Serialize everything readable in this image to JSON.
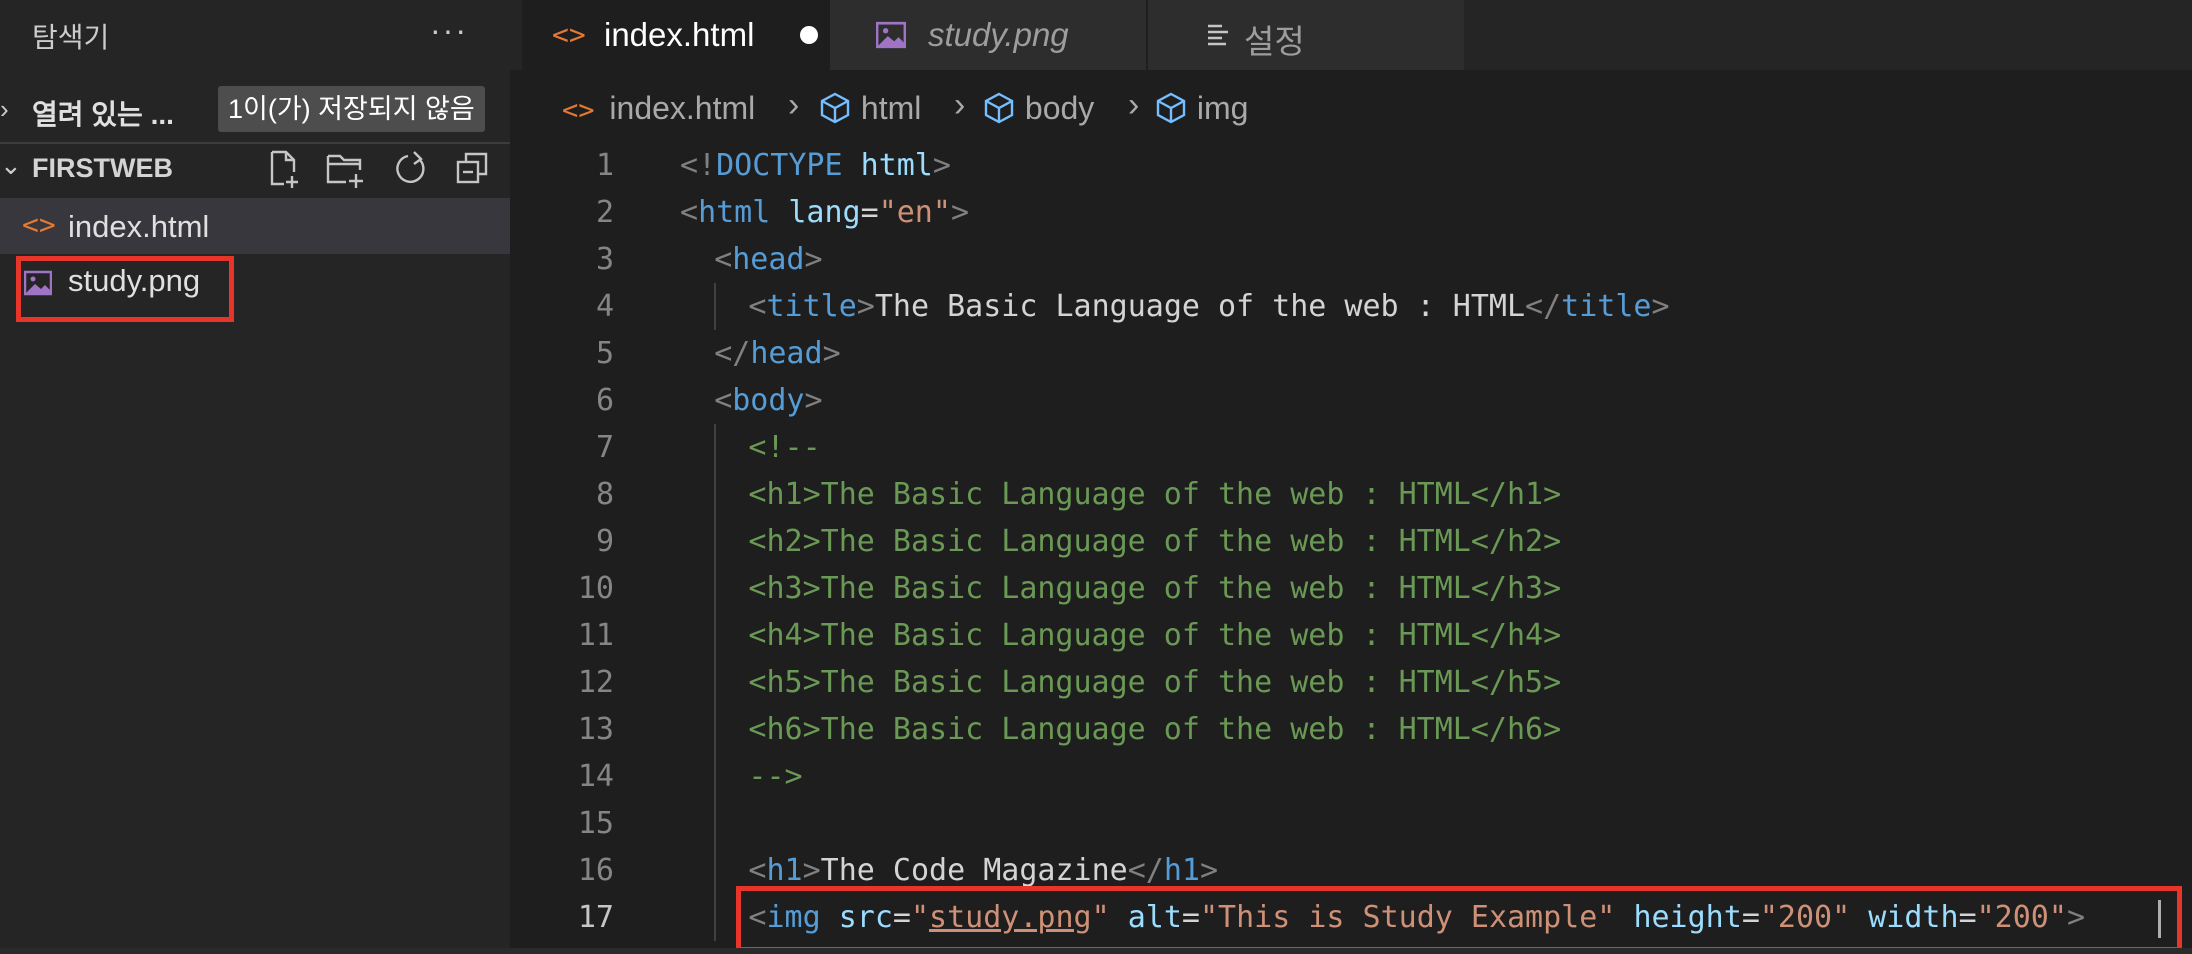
{
  "sidebar": {
    "title": "탐색기",
    "more_label": "···",
    "open_editors_label": "열려 있는 ...",
    "unsaved_badge": "1이(가) 저장되지 않음",
    "folder_label": "FIRSTWEB",
    "toolbar_icons": [
      "new-file-icon",
      "new-folder-icon",
      "refresh-icon",
      "collapse-all-icon"
    ],
    "files": [
      {
        "name": "index.html",
        "icon": "html-file-icon",
        "selected": true
      },
      {
        "name": "study.png",
        "icon": "image-file-icon",
        "selected": false
      }
    ]
  },
  "tabs": [
    {
      "label": "index.html",
      "icon": "html-file-icon",
      "active": true,
      "dirty": true
    },
    {
      "label": "study.png",
      "icon": "image-file-icon",
      "active": false,
      "preview": true
    },
    {
      "label": "설정",
      "icon": "settings-list-icon",
      "active": false
    }
  ],
  "breadcrumb": [
    "index.html",
    "html",
    "body",
    "img"
  ],
  "code": {
    "active_line": 17,
    "lines": [
      {
        "n": "1",
        "tokens": [
          [
            "tg",
            "<!"
          ],
          [
            "tn",
            "DOCTYPE"
          ],
          [
            "tx",
            " "
          ],
          [
            "at",
            "html"
          ],
          [
            "tg",
            ">"
          ]
        ],
        "indent": 0
      },
      {
        "n": "2",
        "tokens": [
          [
            "tg",
            "<"
          ],
          [
            "tn",
            "html"
          ],
          [
            "tx",
            " "
          ],
          [
            "at",
            "lang"
          ],
          [
            "tx",
            "="
          ],
          [
            "st",
            "\"en\""
          ],
          [
            "tg",
            ">"
          ]
        ],
        "indent": 0
      },
      {
        "n": "3",
        "tokens": [
          [
            "tg",
            "<"
          ],
          [
            "tn",
            "head"
          ],
          [
            "tg",
            ">"
          ]
        ],
        "indent": 1
      },
      {
        "n": "4",
        "tokens": [
          [
            "tg",
            "<"
          ],
          [
            "tn",
            "title"
          ],
          [
            "tg",
            ">"
          ],
          [
            "tx",
            "The Basic Language of the web : HTML"
          ],
          [
            "tg",
            "</"
          ],
          [
            "tn",
            "title"
          ],
          [
            "tg",
            ">"
          ]
        ],
        "indent": 2
      },
      {
        "n": "5",
        "tokens": [
          [
            "tg",
            "</"
          ],
          [
            "tn",
            "head"
          ],
          [
            "tg",
            ">"
          ]
        ],
        "indent": 1
      },
      {
        "n": "6",
        "tokens": [
          [
            "tg",
            "<"
          ],
          [
            "tn",
            "body"
          ],
          [
            "tg",
            ">"
          ]
        ],
        "indent": 1
      },
      {
        "n": "7",
        "tokens": [
          [
            "cm",
            "<!--"
          ]
        ],
        "indent": 2
      },
      {
        "n": "8",
        "tokens": [
          [
            "cm",
            "<h1>The Basic Language of the web : HTML</h1>"
          ]
        ],
        "indent": 2
      },
      {
        "n": "9",
        "tokens": [
          [
            "cm",
            "<h2>The Basic Language of the web : HTML</h2>"
          ]
        ],
        "indent": 2
      },
      {
        "n": "10",
        "tokens": [
          [
            "cm",
            "<h3>The Basic Language of the web : HTML</h3>"
          ]
        ],
        "indent": 2
      },
      {
        "n": "11",
        "tokens": [
          [
            "cm",
            "<h4>The Basic Language of the web : HTML</h4>"
          ]
        ],
        "indent": 2
      },
      {
        "n": "12",
        "tokens": [
          [
            "cm",
            "<h5>The Basic Language of the web : HTML</h5>"
          ]
        ],
        "indent": 2
      },
      {
        "n": "13",
        "tokens": [
          [
            "cm",
            "<h6>The Basic Language of the web : HTML</h6>"
          ]
        ],
        "indent": 2
      },
      {
        "n": "14",
        "tokens": [
          [
            "cm",
            "-->"
          ]
        ],
        "indent": 2
      },
      {
        "n": "15",
        "tokens": [],
        "indent": 2
      },
      {
        "n": "16",
        "tokens": [
          [
            "tg",
            "<"
          ],
          [
            "tn",
            "h1"
          ],
          [
            "tg",
            ">"
          ],
          [
            "tx",
            "The Code Magazine"
          ],
          [
            "tg",
            "</"
          ],
          [
            "tn",
            "h1"
          ],
          [
            "tg",
            ">"
          ]
        ],
        "indent": 2
      },
      {
        "n": "17",
        "tokens": [
          [
            "tg",
            "<"
          ],
          [
            "tn",
            "img"
          ],
          [
            "tx",
            " "
          ],
          [
            "at",
            "src"
          ],
          [
            "tx",
            "="
          ],
          [
            "st",
            "\""
          ],
          [
            "stu",
            "study.png"
          ],
          [
            "st",
            "\""
          ],
          [
            "tx",
            " "
          ],
          [
            "at",
            "alt"
          ],
          [
            "tx",
            "="
          ],
          [
            "st",
            "\"This is Study Example\""
          ],
          [
            "tx",
            " "
          ],
          [
            "at",
            "height"
          ],
          [
            "tx",
            "="
          ],
          [
            "st",
            "\"200\""
          ],
          [
            "tx",
            " "
          ],
          [
            "at",
            "width"
          ],
          [
            "tx",
            "="
          ],
          [
            "st",
            "\"200\""
          ],
          [
            "tg",
            ">"
          ]
        ],
        "indent": 2
      }
    ]
  },
  "colors": {
    "highlight_box": "#e8352a",
    "tag_name": "#569cd6",
    "attribute": "#9cdcfe",
    "string": "#ce9178",
    "comment": "#6a9955",
    "html_icon": "#e37933",
    "image_icon": "#a074c4"
  }
}
